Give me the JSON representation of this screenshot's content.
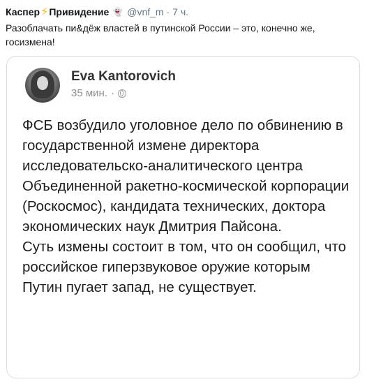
{
  "tweet": {
    "name_part1": "Каспер",
    "name_part2": "Привидение",
    "handle": "@vnf_m",
    "separator": "·",
    "time": "7 ч.",
    "text": "Разоблачать пи&дёж властей в путинской России – это, конечно же, госизмена!"
  },
  "embed": {
    "author": "Eva Kantorovich",
    "time": "35 мин.",
    "separator": "·",
    "paragraph1": "ФСБ возбудило уголовное дело по обвинению в государственной измене директора исследовательско-аналитического центра Объединенной ракетно-космической корпорации (Роскосмос), кандидата технических, доктора экономических наук Дмитрия Пайсона.",
    "paragraph2": "Суть измены состоит в том, что он сообщил, что российское гиперзвуковое оружие которым Путин пугает запад, не существует."
  },
  "icons": {
    "bolt": "lightning-icon",
    "ghost": "ghost-icon",
    "globe": "globe-icon"
  },
  "colors": {
    "bolt": "#f5b800",
    "secondary_text": "#657786",
    "border": "#d8dde1"
  }
}
